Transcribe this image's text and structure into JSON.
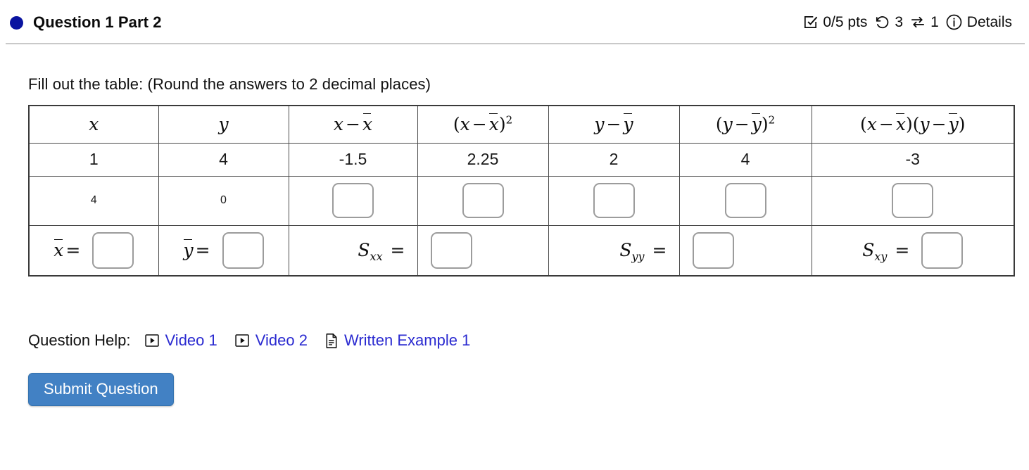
{
  "header": {
    "title": "Question 1 Part 2",
    "status_color": "#0a14a0",
    "points": "0/5 pts",
    "attempts": "3",
    "retries": "1",
    "details_label": "Details"
  },
  "prompt": "Fill out the table: (Round the answers to 2 decimal places)",
  "table": {
    "columns": [
      {
        "id": "x",
        "label_kind": "math-x"
      },
      {
        "id": "y",
        "label_kind": "math-y"
      },
      {
        "id": "x_dev",
        "label_kind": "math-x-minus-xbar"
      },
      {
        "id": "x_dev_sq",
        "label_kind": "math-x-minus-xbar-sq"
      },
      {
        "id": "y_dev",
        "label_kind": "math-y-minus-ybar"
      },
      {
        "id": "y_dev_sq",
        "label_kind": "math-y-minus-ybar-sq"
      },
      {
        "id": "xy_dev",
        "label_kind": "math-cross-product"
      }
    ],
    "rows": [
      {
        "type": "values",
        "cells": [
          "1",
          "4",
          "-1.5",
          "2.25",
          "2",
          "4",
          "-3"
        ]
      },
      {
        "type": "mixed",
        "cells": [
          "4",
          "0",
          "",
          "",
          "",
          "",
          ""
        ],
        "input_columns": [
          2,
          3,
          4,
          5,
          6
        ]
      }
    ],
    "summary_row": {
      "xbar_label": "x̄ =",
      "ybar_label": "ȳ =",
      "sxx_label": "Sxx =",
      "syy_label": "Syy =",
      "sxy_label": "Sxy =",
      "xbar_value": "",
      "ybar_value": "",
      "sxx_value": "",
      "syy_value": "",
      "sxy_value": ""
    },
    "input_placeholder": ""
  },
  "help": {
    "label": "Question Help:",
    "links": [
      {
        "text": "Video 1",
        "icon": "video-icon"
      },
      {
        "text": "Video 2",
        "icon": "video-icon"
      },
      {
        "text": "Written Example 1",
        "icon": "document-icon"
      }
    ],
    "link_color": "#2a2ad0"
  },
  "submit": {
    "label": "Submit Question",
    "color": "#4281c4"
  }
}
